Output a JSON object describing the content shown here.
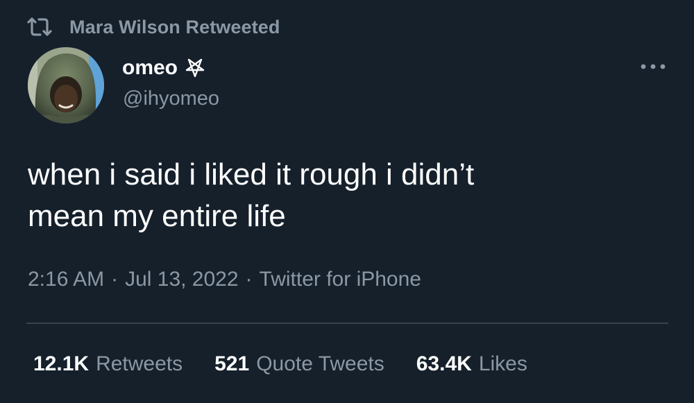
{
  "context": {
    "icon": "retweet-icon",
    "text": "Mara Wilson Retweeted"
  },
  "author": {
    "display_name": "omeo",
    "badge_icon": "pentagram-icon",
    "handle": "@ihyomeo",
    "avatar_icon": "hooded-person-avatar"
  },
  "more_icon": "more-options-icon",
  "tweet": {
    "text": "when i said i liked it rough i didn’t\nmean my entire life",
    "time": "2:16 AM",
    "separator": "·",
    "date": "Jul 13, 2022",
    "source": "Twitter for iPhone"
  },
  "stats": {
    "retweets": {
      "count": "12.1K",
      "label": "Retweets"
    },
    "quotes": {
      "count": "521",
      "label": "Quote Tweets"
    },
    "likes": {
      "count": "63.4K",
      "label": "Likes"
    }
  },
  "colors": {
    "background": "#15202b",
    "primary_text": "#ffffff",
    "secondary_text": "#8b98a5",
    "divider": "#38444d"
  }
}
